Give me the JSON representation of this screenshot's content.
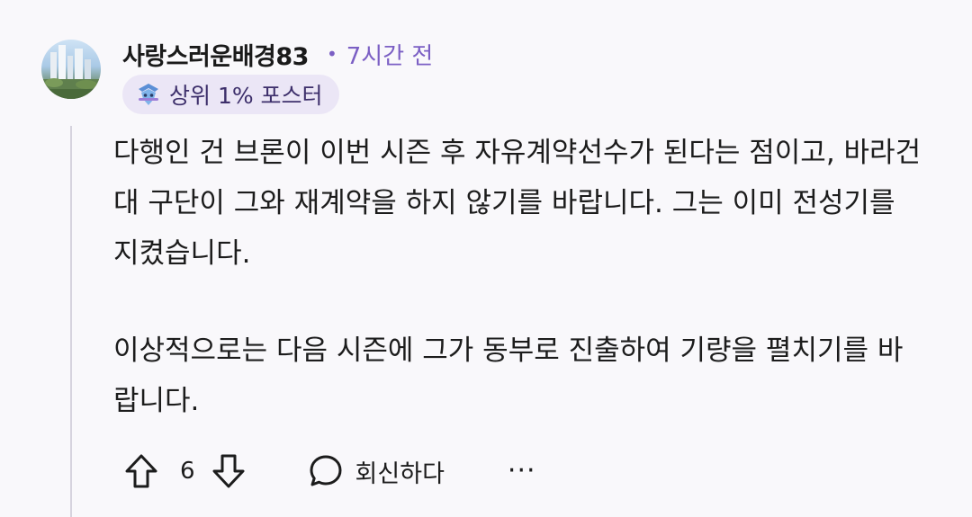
{
  "comment": {
    "author": "사랑스러운배경83",
    "separator": "•",
    "time_ago": "7시간 전",
    "badge": {
      "icon": "top-poster-icon",
      "label": "상위 1% 포스터"
    },
    "paragraphs": [
      "다행인 건 브론이 이번 시즌 후 자유계약선수가 된다는 점이고, 바라건대 구단이 그와 재계약을 하지 않기를 바랍니다. 그는 이미 전성기를 지켰습니다.",
      "이상적으로는 다음 시즌에 그가 동부로 진출하여 기량을 펼치기를 바랍니다."
    ],
    "actions": {
      "upvote_icon": "arrow-up-icon",
      "vote_count": "6",
      "downvote_icon": "arrow-down-icon",
      "reply_icon": "speech-bubble-icon",
      "reply_label": "회신하다",
      "more_label": "···"
    }
  },
  "colors": {
    "background": "#f9f8fb",
    "accent": "#7b5fc4",
    "badge_bg": "#ebe6f6"
  }
}
